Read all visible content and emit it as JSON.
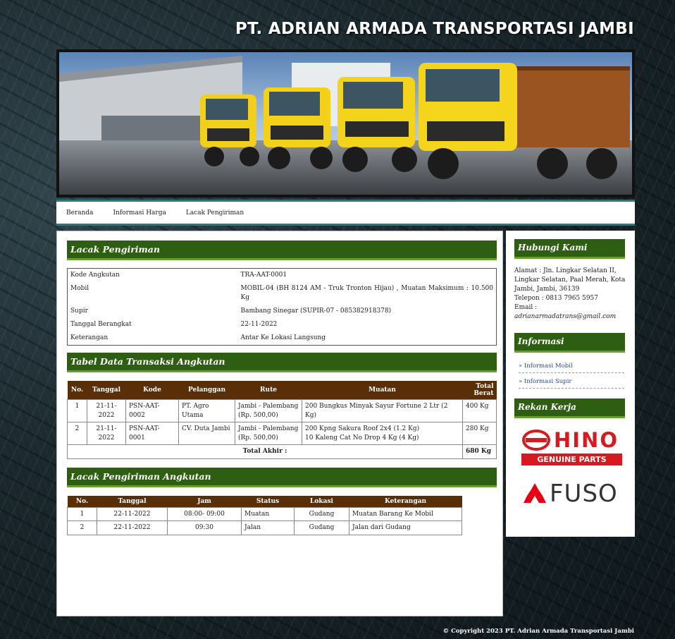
{
  "site": {
    "title": "PT. ADRIAN ARMADA TRANSPORTASI JAMBI",
    "footer": "© Copyright 2023 PT. Adrian Armada Transportasi Jambi"
  },
  "nav": {
    "items": [
      "Beranda",
      "Informasi Harga",
      "Lacak Pengiriman"
    ]
  },
  "lacak": {
    "heading": "Lacak Pengiriman",
    "rows": [
      {
        "label": "Kode Angkutan",
        "value": "TRA-AAT-0001"
      },
      {
        "label": "Mobil",
        "value": "MOBIL-04 (BH 8124 AM - Truk Tronton Hijau) , Muatan Maksimum : 10.500 Kg"
      },
      {
        "label": "Supir",
        "value": "Bambang Sinegar (SUPIR-07 - 085382918378)"
      },
      {
        "label": "Tanggal Berangkat",
        "value": "22-11-2022"
      },
      {
        "label": "Keterangan",
        "value": "Antar Ke Lokasi Langsung"
      }
    ]
  },
  "transaksi": {
    "heading": "Tabel Data Transaksi Angkutan",
    "columns": [
      "No.",
      "Tanggal",
      "Kode",
      "Pelanggan",
      "Rute",
      "Muatan",
      "Total Berat"
    ],
    "rows": [
      {
        "no": "1",
        "tanggal": "21-11-2022",
        "kode": "PSN-AAT-0002",
        "pelanggan": "PT. Agro Utama",
        "rute": "Jambi - Palembang (Rp. 500,00)",
        "muatan": "200 Bungkus Minyak Sayur Fortune 2 Ltr (2 Kg)",
        "berat": "400 Kg"
      },
      {
        "no": "2",
        "tanggal": "21-11-2022",
        "kode": "PSN-AAT-0001",
        "pelanggan": "CV. Duta Jambi",
        "rute": "Jambi - Palembang (Rp. 500,00)",
        "muatan": "200 Kpng Sakura Roof 2x4 (1.2 Kg)\n10 Kaleng Cat No Drop 4 Kg (4 Kg)",
        "berat": "280 Kg"
      }
    ],
    "total_label": "Total Akhir :",
    "total_value": "680 Kg"
  },
  "tracking": {
    "heading": "Lacak Pengiriman Angkutan",
    "columns": [
      "No.",
      "Tanggal",
      "Jam",
      "Status",
      "Lokasi",
      "Keterangan"
    ],
    "rows": [
      {
        "no": "1",
        "tanggal": "22-11-2022",
        "jam": "08:00- 09:00",
        "status": "Muatan",
        "lokasi": "Gudang",
        "keterangan": "Muatan Barang Ke Mobil"
      },
      {
        "no": "2",
        "tanggal": "22-11-2022",
        "jam": "09:30",
        "status": "Jalan",
        "lokasi": "Gudang",
        "keterangan": "Jalan dari Gudang"
      }
    ]
  },
  "sidebar": {
    "hubungi": {
      "heading": "Hubungi Kami",
      "alamat": "Alamat : Jln. Lingkar Selatan II, Lingkar Selatan, Paal Merah, Kota Jambi, Jambi, 36139",
      "telepon": "Telepon : 0813 7965 5957",
      "email_label": "Email :",
      "email": "adrianarmadatrans@gmail.com"
    },
    "informasi": {
      "heading": "Informasi",
      "links": [
        "» Informasi Mobil",
        "» Informasi Supir"
      ]
    },
    "rekan": {
      "heading": "Rekan Kerja",
      "hino": "HINO",
      "hino_sub": "GENUINE PARTS",
      "fuso": "FUSO",
      "hino_color": "#d71920",
      "fuso_color": "#e60012"
    }
  }
}
